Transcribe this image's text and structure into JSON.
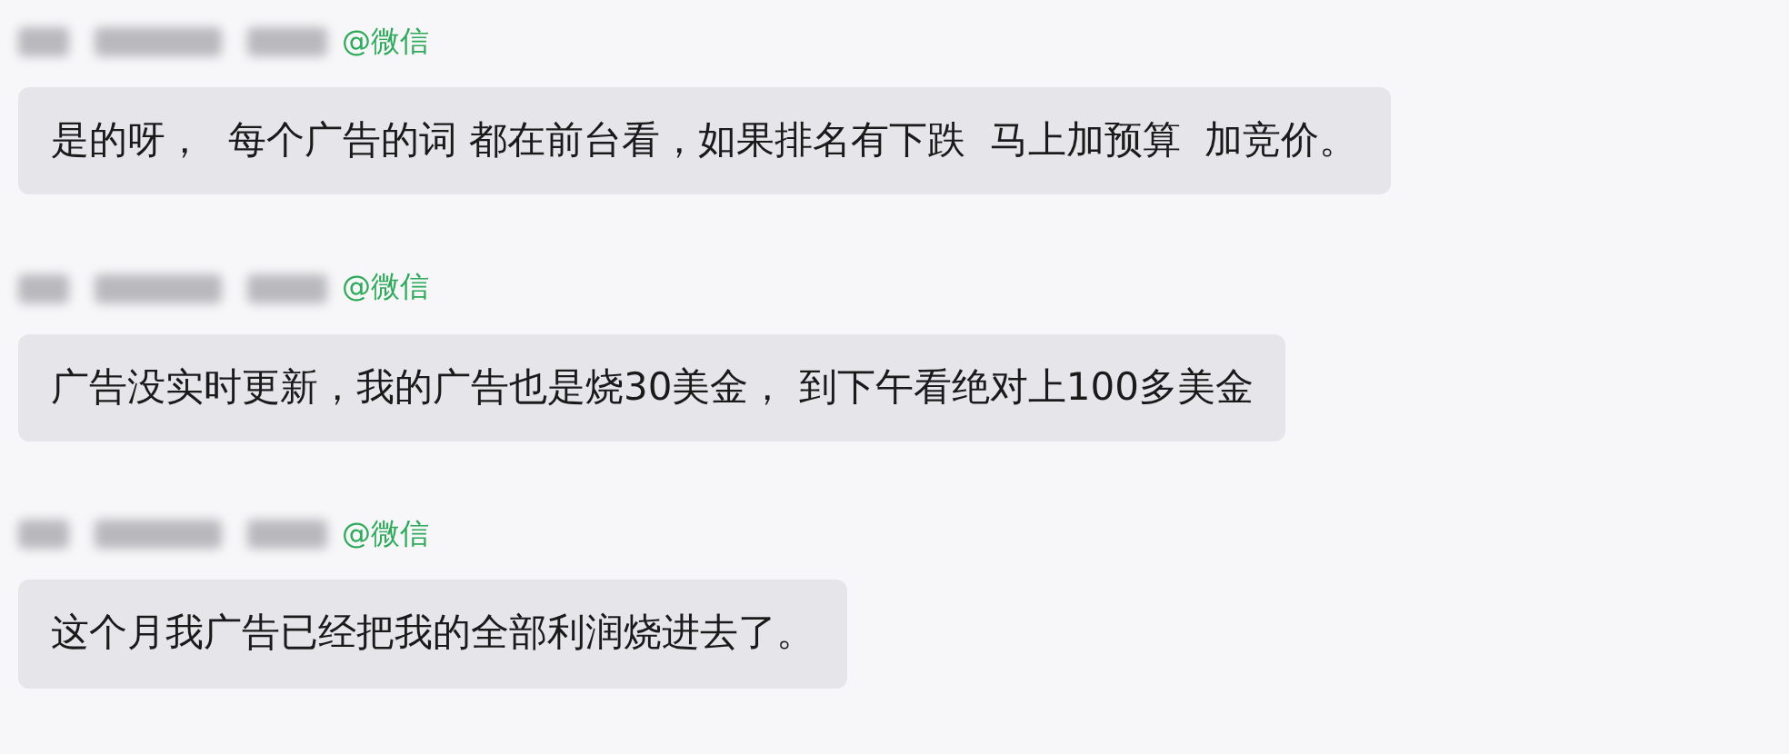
{
  "messages": [
    {
      "source": "@微信",
      "text": "是的呀，  每个广告的词 都在前台看，如果排名有下跌  马上加预算  加竞价。"
    },
    {
      "source": "@微信",
      "text": "广告没实时更新，我的广告也是烧30美金， 到下午看绝对上100多美金"
    },
    {
      "source": "@微信",
      "text": "这个月我广告已经把我的全部利润烧进去了。"
    }
  ]
}
